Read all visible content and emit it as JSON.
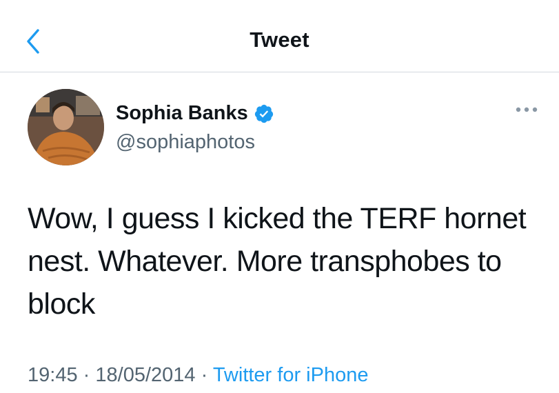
{
  "header": {
    "title": "Tweet",
    "back_icon": "chevron-left-icon"
  },
  "tweet": {
    "author": {
      "name": "Sophia Banks",
      "handle": "@sophiaphotos",
      "verified": true,
      "avatar_icon": "profile-photo"
    },
    "text": "Wow, I guess I kicked the TERF hornet nest. Whatever. More transphobes to block",
    "time": "19:45",
    "date": "18/05/2014",
    "separator": "·",
    "source": "Twitter for iPhone",
    "more_icon": "more-options-icon"
  },
  "colors": {
    "accent": "#1d9bf0",
    "secondary_text": "#536471",
    "divider": "#d4d9de"
  }
}
